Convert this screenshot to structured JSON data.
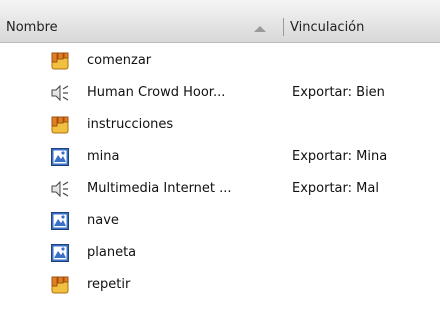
{
  "header": {
    "name_label": "Nombre",
    "link_label": "Vinculación"
  },
  "rows": [
    {
      "name": "comenzar",
      "link": "",
      "icon": "movieclip-icon"
    },
    {
      "name": "Human Crowd Hoor...",
      "link": "Exportar: Bien",
      "icon": "sound-icon"
    },
    {
      "name": "instrucciones",
      "link": "",
      "icon": "movieclip-icon"
    },
    {
      "name": "mina",
      "link": "Exportar: Mina",
      "icon": "graphic-icon"
    },
    {
      "name": "Multimedia Internet ...",
      "link": "Exportar: Mal",
      "icon": "sound-icon"
    },
    {
      "name": "nave",
      "link": "",
      "icon": "graphic-icon"
    },
    {
      "name": "planeta",
      "link": "",
      "icon": "graphic-icon"
    },
    {
      "name": "repetir",
      "link": "",
      "icon": "movieclip-icon"
    }
  ]
}
